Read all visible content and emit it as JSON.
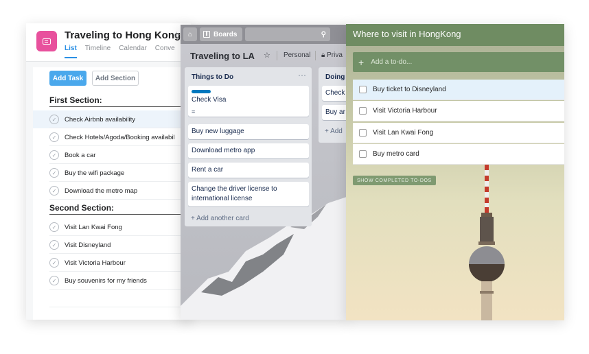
{
  "asana": {
    "project_title": "Traveling to Hong Kong",
    "tabs": [
      {
        "label": "List",
        "active": true
      },
      {
        "label": "Timeline",
        "active": false
      },
      {
        "label": "Calendar",
        "active": false
      },
      {
        "label": "Conve",
        "active": false
      }
    ],
    "add_task_label": "Add Task",
    "add_section_label": "Add Section",
    "sections": [
      {
        "title": "First Section:",
        "tasks": [
          "Check Airbnb availability",
          "Check Hotels/Agoda/Booking availabil",
          "Book a car",
          "Buy the wifi package",
          "Download the metro map"
        ]
      },
      {
        "title": "Second Section:",
        "tasks": [
          "Visit Lan Kwai Fong",
          "Visit Disneyland",
          "Visit Victoria Harbour",
          "Buy souvenirs for my friends"
        ]
      }
    ],
    "accent_color": "#e8519d",
    "button_color": "#4aa8ec"
  },
  "trello": {
    "boards_label": "Boards",
    "board_title": "Traveling to LA",
    "visibility_personal": "Personal",
    "visibility_private": "Priva",
    "lists": [
      {
        "title": "Things to Do",
        "more": "···",
        "cards": [
          "Check Visa",
          "Buy new luggage",
          "Download metro app",
          "Rent a car",
          "Change the driver license to",
          "international license"
        ],
        "add_card": "+ Add another card"
      },
      {
        "title": "Doing",
        "cards": [
          "Check",
          "Buy ar"
        ],
        "add_card": "+ Add"
      }
    ],
    "label_color": "#0079bf"
  },
  "wunderlist": {
    "list_title": "Where to visit in HongKong",
    "add_placeholder": "Add a to-do...",
    "todos": [
      {
        "label": "Buy ticket to Disneyland",
        "selected": true
      },
      {
        "label": "Visit Victoria Harbour",
        "selected": false
      },
      {
        "label": "Visit Lan Kwai Fong",
        "selected": false
      },
      {
        "label": "Buy metro card",
        "selected": false
      }
    ],
    "show_completed_label": "SHOW COMPLETED TO-DOS",
    "header_color": "#6f8c62"
  }
}
